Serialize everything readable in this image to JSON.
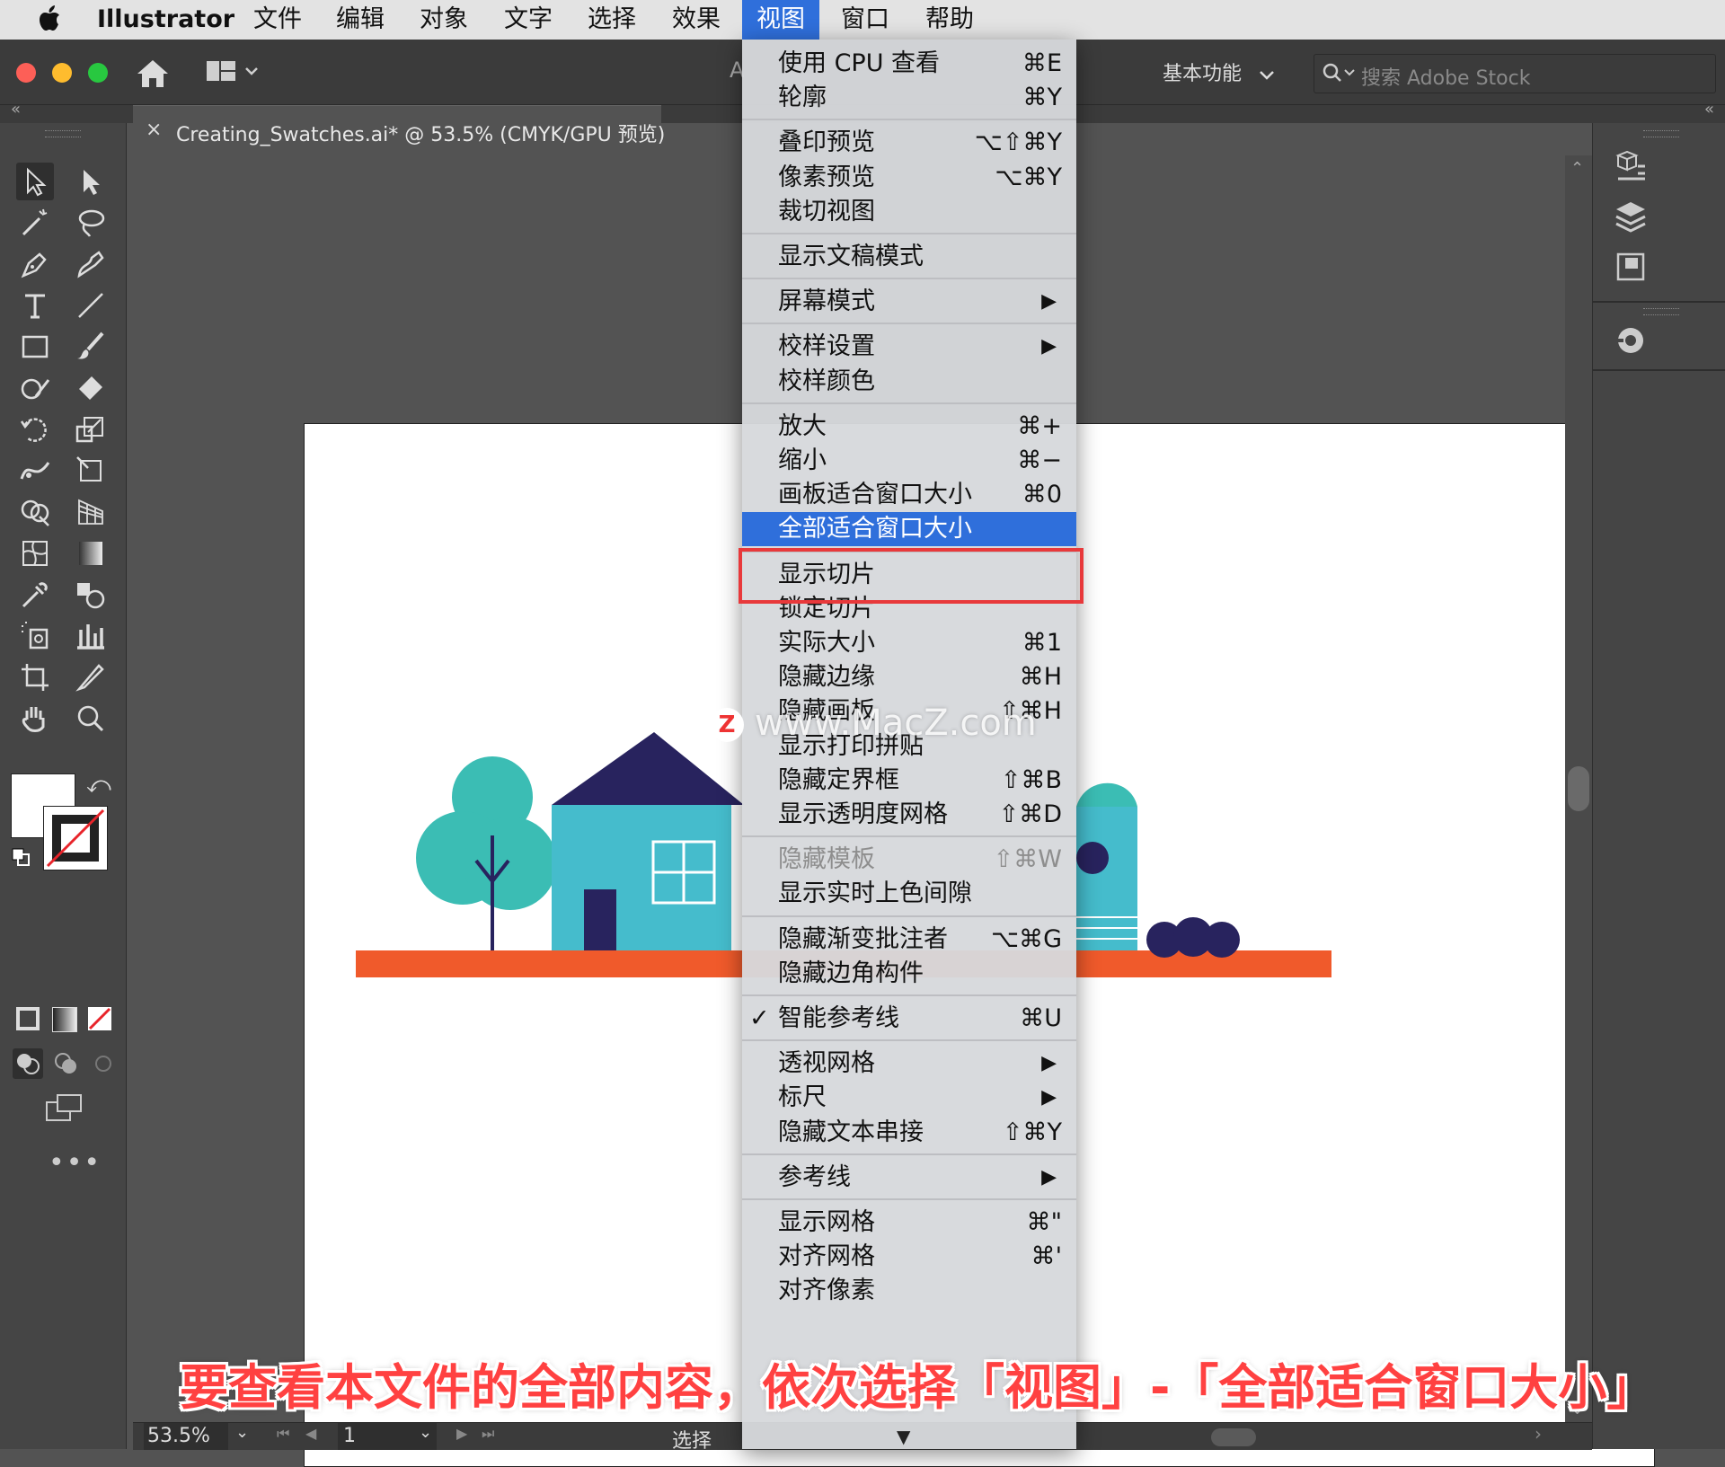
{
  "menubar": {
    "app_name": "Illustrator",
    "items": [
      "文件",
      "编辑",
      "对象",
      "文字",
      "选择",
      "效果",
      "视图",
      "窗口",
      "帮助"
    ],
    "active_item": "视图"
  },
  "appbar": {
    "workspace_label": "基本功能",
    "search_placeholder": "搜索 Adobe Stock",
    "partial_letter": "A"
  },
  "document": {
    "tab_close": "×",
    "tab_title": "Creating_Swatches.ai* @ 53.5% (CMYK/GPU 预览)"
  },
  "view_menu": {
    "groups": [
      [
        {
          "label": "使用 CPU 查看",
          "shortcut": "⌘E"
        },
        {
          "label": "轮廓",
          "shortcut": "⌘Y"
        }
      ],
      [
        {
          "label": "叠印预览",
          "shortcut": "⌥⇧⌘Y"
        },
        {
          "label": "像素预览",
          "shortcut": "⌥⌘Y"
        },
        {
          "label": "裁切视图",
          "shortcut": ""
        }
      ],
      [
        {
          "label": "显示文稿模式",
          "shortcut": ""
        }
      ],
      [
        {
          "label": "屏幕模式",
          "submenu": true
        }
      ],
      [
        {
          "label": "校样设置",
          "submenu": true
        },
        {
          "label": "校样颜色",
          "shortcut": ""
        }
      ],
      [
        {
          "label": "放大",
          "shortcut": "⌘+"
        },
        {
          "label": "缩小",
          "shortcut": "⌘−"
        },
        {
          "label": "画板适合窗口大小",
          "shortcut": "⌘0"
        },
        {
          "label": "全部适合窗口大小",
          "shortcut": "",
          "highlighted": true
        }
      ],
      [
        {
          "label": "显示切片",
          "shortcut": ""
        },
        {
          "label": "锁定切片",
          "shortcut": ""
        },
        {
          "label": "实际大小",
          "shortcut": "⌘1"
        },
        {
          "label": "隐藏边缘",
          "shortcut": "⌘H"
        },
        {
          "label": "隐藏画板",
          "shortcut": "⇧⌘H"
        },
        {
          "label": "显示打印拼贴",
          "shortcut": ""
        },
        {
          "label": "隐藏定界框",
          "shortcut": "⇧⌘B"
        },
        {
          "label": "显示透明度网格",
          "shortcut": "⇧⌘D"
        }
      ],
      [
        {
          "label": "隐藏模板",
          "shortcut": "⇧⌘W",
          "disabled": true
        },
        {
          "label": "显示实时上色间隙",
          "shortcut": ""
        }
      ],
      [
        {
          "label": "隐藏渐变批注者",
          "shortcut": "⌥⌘G"
        },
        {
          "label": "隐藏边角构件",
          "shortcut": ""
        }
      ],
      [
        {
          "label": "智能参考线",
          "shortcut": "⌘U",
          "checked": true
        }
      ],
      [
        {
          "label": "透视网格",
          "submenu": true
        },
        {
          "label": "标尺",
          "submenu": true
        },
        {
          "label": "隐藏文本串接",
          "shortcut": "⇧⌘Y"
        }
      ],
      [
        {
          "label": "参考线",
          "submenu": true
        }
      ],
      [
        {
          "label": "显示网格",
          "shortcut": "⌘\""
        },
        {
          "label": "对齐网格",
          "shortcut": "⌘'"
        },
        {
          "label": "对齐像素",
          "shortcut": ""
        }
      ]
    ],
    "check_mark": "✓",
    "submenu_arrow": "▶",
    "scroll_arrow": "▼"
  },
  "statusbar": {
    "zoom": "53.5%",
    "artboard_number": "1",
    "tool_name": "选择"
  },
  "overlay": {
    "watermark": "www.MacZ.com",
    "watermark_logo": "Z",
    "caption": "要查看本文件的全部内容，依次选择「视图」-「全部适合窗口大小」"
  },
  "colors": {
    "menu_highlight": "#2f6fdb",
    "annotation_red": "#e8393b",
    "ground_orange": "#f05a2b",
    "house_blue": "#45bccc",
    "roof_navy": "#28235e",
    "tree_teal": "#3bbdb4"
  }
}
